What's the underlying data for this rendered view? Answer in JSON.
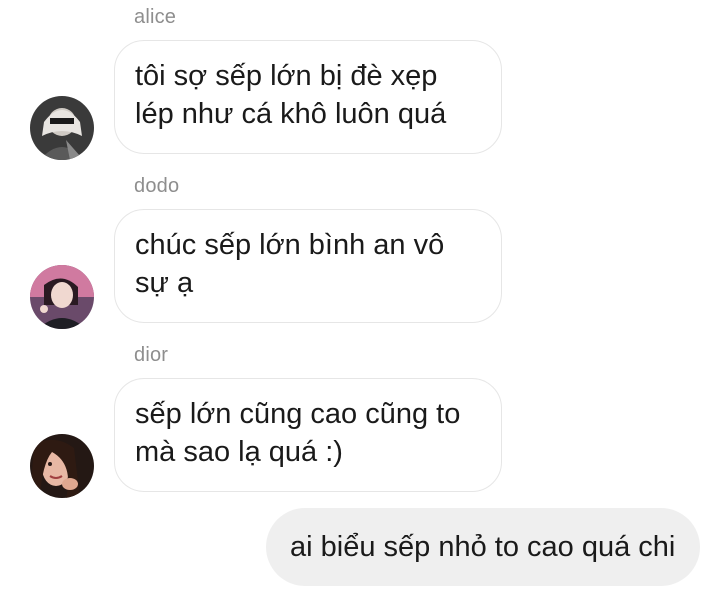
{
  "messages": [
    {
      "sender": "alice",
      "text": "tôi sợ sếp lớn bị đè xẹp lép như cá khô luôn quá",
      "avatar": "avatar-photo"
    },
    {
      "sender": "dodo",
      "text": "chúc sếp lớn bình an vô sự ạ",
      "avatar": "avatar-photo"
    },
    {
      "sender": "dior",
      "text": "sếp lớn cũng cao cũng to mà sao lạ quá :)",
      "avatar": "avatar-photo"
    }
  ],
  "own_message": {
    "text": "ai biểu sếp nhỏ to cao quá chi"
  },
  "colors": {
    "sender_name": "#8e8e8e",
    "incoming_border": "#e6e6e6",
    "outgoing_bg": "#efefef",
    "text": "#1a1a1a"
  }
}
